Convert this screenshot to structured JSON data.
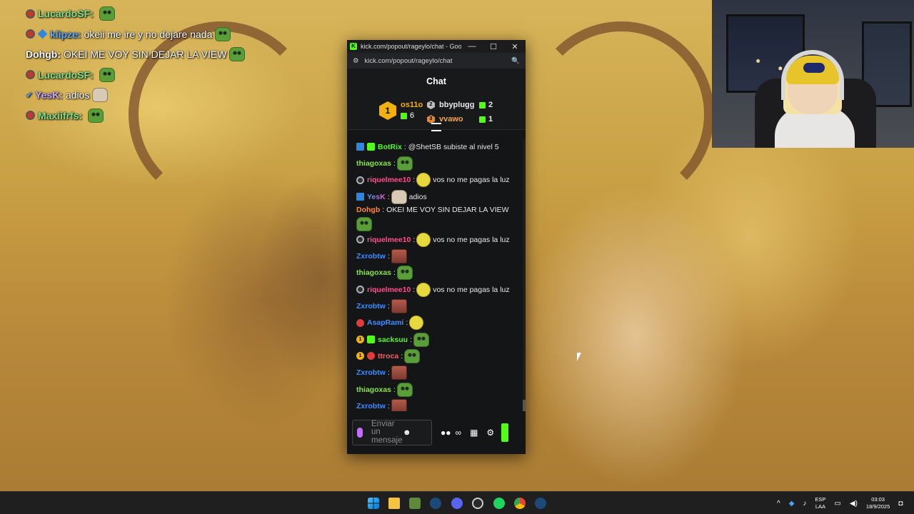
{
  "overlay_chat": [
    {
      "badge": "round",
      "name": "LucardoSF:",
      "name_color": "#7fe08a",
      "text": "",
      "emote": "pepe"
    },
    {
      "badge": "round-blue",
      "name": "klipze:",
      "name_color": "#5aa9ff",
      "text": "okeii me ire y no dejare nada",
      "emote": "pepe"
    },
    {
      "badge": "",
      "name": "Dohgb:",
      "name_color": "#ffffff",
      "text": "OKEI ME VOY SIN DEJAR LA VIEW",
      "emote": "pepe"
    },
    {
      "badge": "round",
      "name": "LucardoSF:",
      "name_color": "#7fe08a",
      "text": "",
      "emote": "pepe"
    },
    {
      "badge": "tick",
      "name": "YesK:",
      "name_color": "#c7a6ff",
      "text": "adios",
      "emote": "cat"
    },
    {
      "badge": "round",
      "name": "Maxiifrfs:",
      "name_color": "#7fe08a",
      "text": "",
      "emote": "pepe"
    }
  ],
  "browser": {
    "title": "kick.com/popout/rageylo/chat - Goog...",
    "url": "kick.com/popout/rageylo/chat",
    "kick_icon": "K",
    "minimize": "—",
    "maximize": "☐",
    "close": "✕",
    "tune_icon": "⚙",
    "zoom_icon": "🔍"
  },
  "chat": {
    "title": "Chat",
    "leaderboard": {
      "first": {
        "rank": "1",
        "name": "os11o",
        "gifts": "6"
      },
      "second": {
        "rank": "2",
        "name": "bbyplugg",
        "gifts": "2"
      },
      "third": {
        "rank": "3",
        "name": "vvawo",
        "gifts": "1"
      }
    },
    "messages": [
      {
        "badges": [
          "bot",
          "green"
        ],
        "user": "BotRix",
        "user_color": "#53fc18",
        "text": "@ShetSB subiste al nivel 5",
        "emote": ""
      },
      {
        "badges": [],
        "user": "thiagoxas",
        "user_color": "#8be34c",
        "text": "",
        "emote": "pepe"
      },
      {
        "badges": [
          "ring"
        ],
        "user": "riquelmee10",
        "user_color": "#ff4f8b",
        "text": "vos no me pagas la luz",
        "emote": "face"
      },
      {
        "badges": [
          "bot"
        ],
        "user": "YesK",
        "user_color": "grad",
        "text": "adios",
        "emote": "cat"
      },
      {
        "badges": [],
        "user": "Dohgb",
        "user_color": "#ff8a3d",
        "text": "OKEI ME VOY SIN DEJAR LA VIEW",
        "emote": "pepe-below"
      },
      {
        "badges": [
          "ring"
        ],
        "user": "riquelmee10",
        "user_color": "#ff4f8b",
        "text": "vos no me pagas la luz",
        "emote": "face"
      },
      {
        "badges": [],
        "user": "Zxrobtw",
        "user_color": "#3f8cff",
        "text": "",
        "emote": "meat"
      },
      {
        "badges": [],
        "user": "thiagoxas",
        "user_color": "#8be34c",
        "text": "",
        "emote": "pepe"
      },
      {
        "badges": [
          "ring"
        ],
        "user": "riquelmee10",
        "user_color": "#ff4f8b",
        "text": "vos no me pagas la luz",
        "emote": "face"
      },
      {
        "badges": [],
        "user": "Zxrobtw",
        "user_color": "#3f8cff",
        "text": "",
        "emote": "meat"
      },
      {
        "badges": [
          "red"
        ],
        "user": "AsapRami",
        "user_color": "#3f8cff",
        "text": "",
        "emote": "face"
      },
      {
        "badges": [
          "gold",
          "green"
        ],
        "user": "sacksuu",
        "user_color": "#53fc18",
        "text": "",
        "emote": "pepe"
      },
      {
        "badges": [
          "gold",
          "red"
        ],
        "user": "ttroca",
        "user_color": "#ff5a5a",
        "text": "",
        "emote": "pepe"
      },
      {
        "badges": [],
        "user": "Zxrobtw",
        "user_color": "#3f8cff",
        "text": "",
        "emote": "meat"
      },
      {
        "badges": [],
        "user": "thiagoxas",
        "user_color": "#8be34c",
        "text": "",
        "emote": "pepe"
      },
      {
        "badges": [],
        "user": "Zxrobtw",
        "user_color": "#3f8cff",
        "text": "",
        "emote": "meat"
      }
    ],
    "input_placeholder": "Enviar un mensaje",
    "emote_picker": "☻",
    "tools": [
      "●●",
      "∞",
      "▦",
      "⚙"
    ]
  },
  "taskbar": {
    "tray": {
      "lang_top": "ESP",
      "lang_bottom": "LAA",
      "time": "03:03",
      "date": "18/9/2025",
      "chevron": "^"
    }
  }
}
